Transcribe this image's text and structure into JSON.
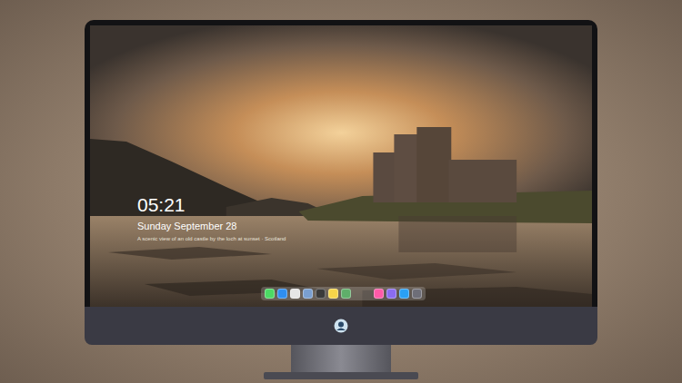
{
  "screen": {
    "clock": "05:21",
    "date": "Sunday September 28",
    "caption": "A scenic view of an old castle by the loch at sunset · Scotland"
  },
  "dock": {
    "groups": [
      [
        {
          "color": "#4cd964"
        },
        {
          "color": "#2f8ef0"
        },
        {
          "color": "#e6e6e6"
        },
        {
          "color": "#7a9fd0"
        },
        {
          "color": "#3a3a3a"
        },
        {
          "color": "#f7d54a"
        },
        {
          "color": "#5fae6a"
        }
      ],
      [
        {
          "color": "#ff5aa8"
        },
        {
          "color": "#8a6cf0"
        },
        {
          "color": "#2aa0f5"
        },
        {
          "color": "#6e6e78"
        }
      ]
    ]
  }
}
